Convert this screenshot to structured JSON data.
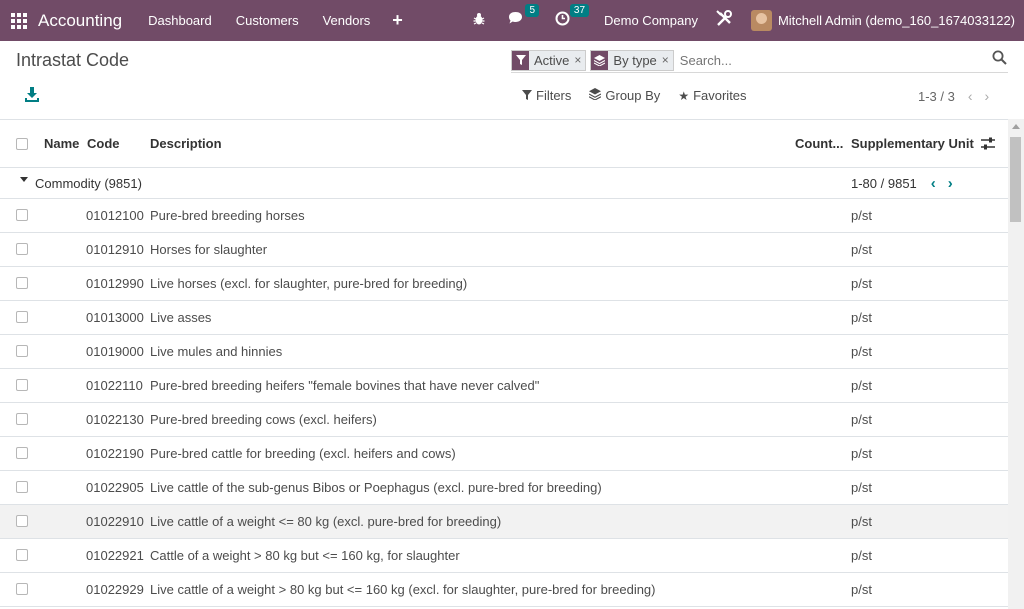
{
  "navbar": {
    "app_name": "Accounting",
    "menu": [
      "Dashboard",
      "Customers",
      "Vendors"
    ],
    "messages_count": "5",
    "activities_count": "37",
    "company": "Demo Company",
    "user": "Mitchell Admin (demo_160_1674033122)",
    "brand_color": "#714b67"
  },
  "control_panel": {
    "title": "Intrastat Code",
    "facets": [
      {
        "icon": "filter-icon",
        "label": "Active"
      },
      {
        "icon": "layers-icon",
        "label": "By type"
      }
    ],
    "search_placeholder": "Search...",
    "filters_label": "Filters",
    "group_by_label": "Group By",
    "favorites_label": "Favorites",
    "pager": "1-3 / 3"
  },
  "table": {
    "headers": {
      "name": "Name",
      "code": "Code",
      "description": "Description",
      "country": "Count...",
      "supplementary_unit": "Supplementary Unit"
    },
    "group": {
      "label": "Commodity (9851)",
      "pager": "1-80 / 9851"
    },
    "rows": [
      {
        "code": "01012100",
        "description": "Pure-bred breeding horses",
        "unit": "p/st"
      },
      {
        "code": "01012910",
        "description": "Horses for slaughter",
        "unit": "p/st"
      },
      {
        "code": "01012990",
        "description": "Live horses (excl. for slaughter, pure-bred for breeding)",
        "unit": "p/st"
      },
      {
        "code": "01013000",
        "description": "Live asses",
        "unit": "p/st"
      },
      {
        "code": "01019000",
        "description": "Live mules and hinnies",
        "unit": "p/st"
      },
      {
        "code": "01022110",
        "description": "Pure-bred breeding heifers \"female bovines that have never calved\"",
        "unit": "p/st"
      },
      {
        "code": "01022130",
        "description": "Pure-bred breeding cows (excl. heifers)",
        "unit": "p/st"
      },
      {
        "code": "01022190",
        "description": "Pure-bred cattle for breeding (excl. heifers and cows)",
        "unit": "p/st"
      },
      {
        "code": "01022905",
        "description": "Live cattle of the sub-genus Bibos or Poephagus (excl. pure-bred for breeding)",
        "unit": "p/st"
      },
      {
        "code": "01022910",
        "description": "Live cattle of a weight <= 80 kg (excl. pure-bred for breeding)",
        "unit": "p/st"
      },
      {
        "code": "01022921",
        "description": "Cattle of a weight > 80 kg but <= 160 kg, for slaughter",
        "unit": "p/st"
      },
      {
        "code": "01022929",
        "description": "Live cattle of a weight > 80 kg but <= 160 kg (excl. for slaughter, pure-bred for breeding)",
        "unit": "p/st"
      }
    ]
  }
}
